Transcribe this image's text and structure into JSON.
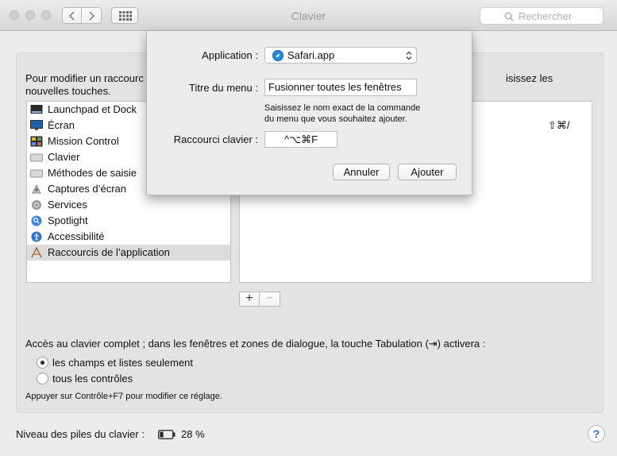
{
  "window": {
    "title": "Clavier",
    "search_placeholder": "Rechercher"
  },
  "instructions": {
    "left": "Pour modifier un raccourci, sélectionnez-le, cliquez sur la combinaison de touches, puis saisissez les nouvelles touches.",
    "left_line1": "Pour modifier un raccourc",
    "left_line2": "nouvelles touches.",
    "right_fragment": "isissez les"
  },
  "categories": [
    {
      "label": "Launchpad et Dock",
      "icon": "launchpad-dock-icon"
    },
    {
      "label": "Écran",
      "icon": "display-icon"
    },
    {
      "label": "Mission Control",
      "icon": "mission-control-icon"
    },
    {
      "label": "Clavier",
      "icon": "keyboard-icon"
    },
    {
      "label": "Méthodes de saisie",
      "icon": "input-methods-icon"
    },
    {
      "label": "Captures d’écran",
      "icon": "screenshot-icon"
    },
    {
      "label": "Services",
      "icon": "gear-icon"
    },
    {
      "label": "Spotlight",
      "icon": "spotlight-icon"
    },
    {
      "label": "Accessibilité",
      "icon": "accessibility-icon"
    },
    {
      "label": "Raccourcis de l’application",
      "icon": "app-shortcuts-icon",
      "selected": true
    }
  ],
  "shortcuts": {
    "visible_key": "⇧⌘/"
  },
  "buttons": {
    "plus": "+",
    "minus": "−"
  },
  "full_access": {
    "label": "Accès au clavier complet ; dans les fenêtres et zones de dialogue, la touche Tabulation (⇥) activera :",
    "options": [
      {
        "label": "les champs et listes seulement",
        "selected": true
      },
      {
        "label": "tous les contrôles",
        "selected": false
      }
    ],
    "hint": "Appuyer sur Contrôle+F7 pour modifier ce réglage."
  },
  "battery": {
    "label": "Niveau des piles du clavier :",
    "percent": "28 %",
    "level": 0.28
  },
  "help_label": "?",
  "sheet": {
    "application_label": "Application :",
    "application_value": "Safari.app",
    "menu_title_label": "Titre du menu :",
    "menu_title_value": "Fusionner toutes les fenêtres",
    "menu_hint_line1": "Saisissez le nom exact de la commande",
    "menu_hint_line2": "du menu que vous souhaitez ajouter.",
    "shortcut_label": "Raccourci clavier :",
    "shortcut_value": "^⌥⌘F",
    "cancel": "Annuler",
    "add": "Ajouter"
  },
  "colors": {
    "window_bg": "#ececec",
    "panel_bg": "#e3e3e3",
    "selection_bg": "#dcdcdc",
    "help_blue": "#2a6fd6",
    "safari_blue": "#2a87e0"
  }
}
